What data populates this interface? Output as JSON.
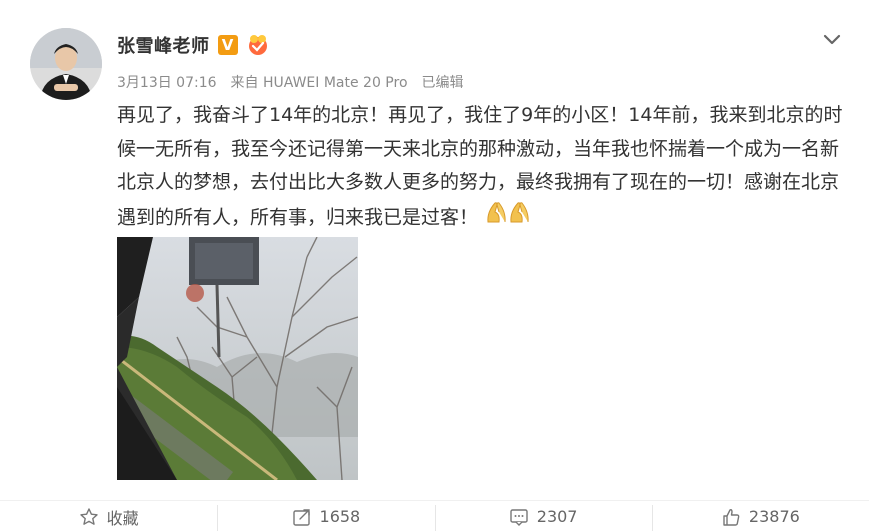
{
  "user": {
    "name": "张雪峰老师",
    "verified_mark": "V"
  },
  "meta": {
    "date": "3月13日 07:16",
    "source": "来自 HUAWEI Mate 20 Pro",
    "edited": "已编辑"
  },
  "post": {
    "text": "再见了，我奋斗了14年的北京！再见了，我住了9年的小区！14年前，我来到北京的时候一无所有，我至今还记得第一天来北京的那种激动，当年我也怀揣着一个成为一名新北京人的梦想，去付出比大多数人更多的努力，最终我拥有了现在的一切！感谢在北京遇到的所有人，所有事，归来我已是过客！"
  },
  "actions": {
    "favorite": "收藏",
    "repost": "1658",
    "comment": "2307",
    "like": "23876"
  },
  "colors": {
    "verified": "#f39c12",
    "text": "#333333",
    "meta": "#8b8b8b"
  },
  "icons": [
    "chevron-down-icon",
    "star-icon",
    "repost-icon",
    "comment-icon",
    "like-icon",
    "praying-hands-icon",
    "level-badge-icon"
  ]
}
